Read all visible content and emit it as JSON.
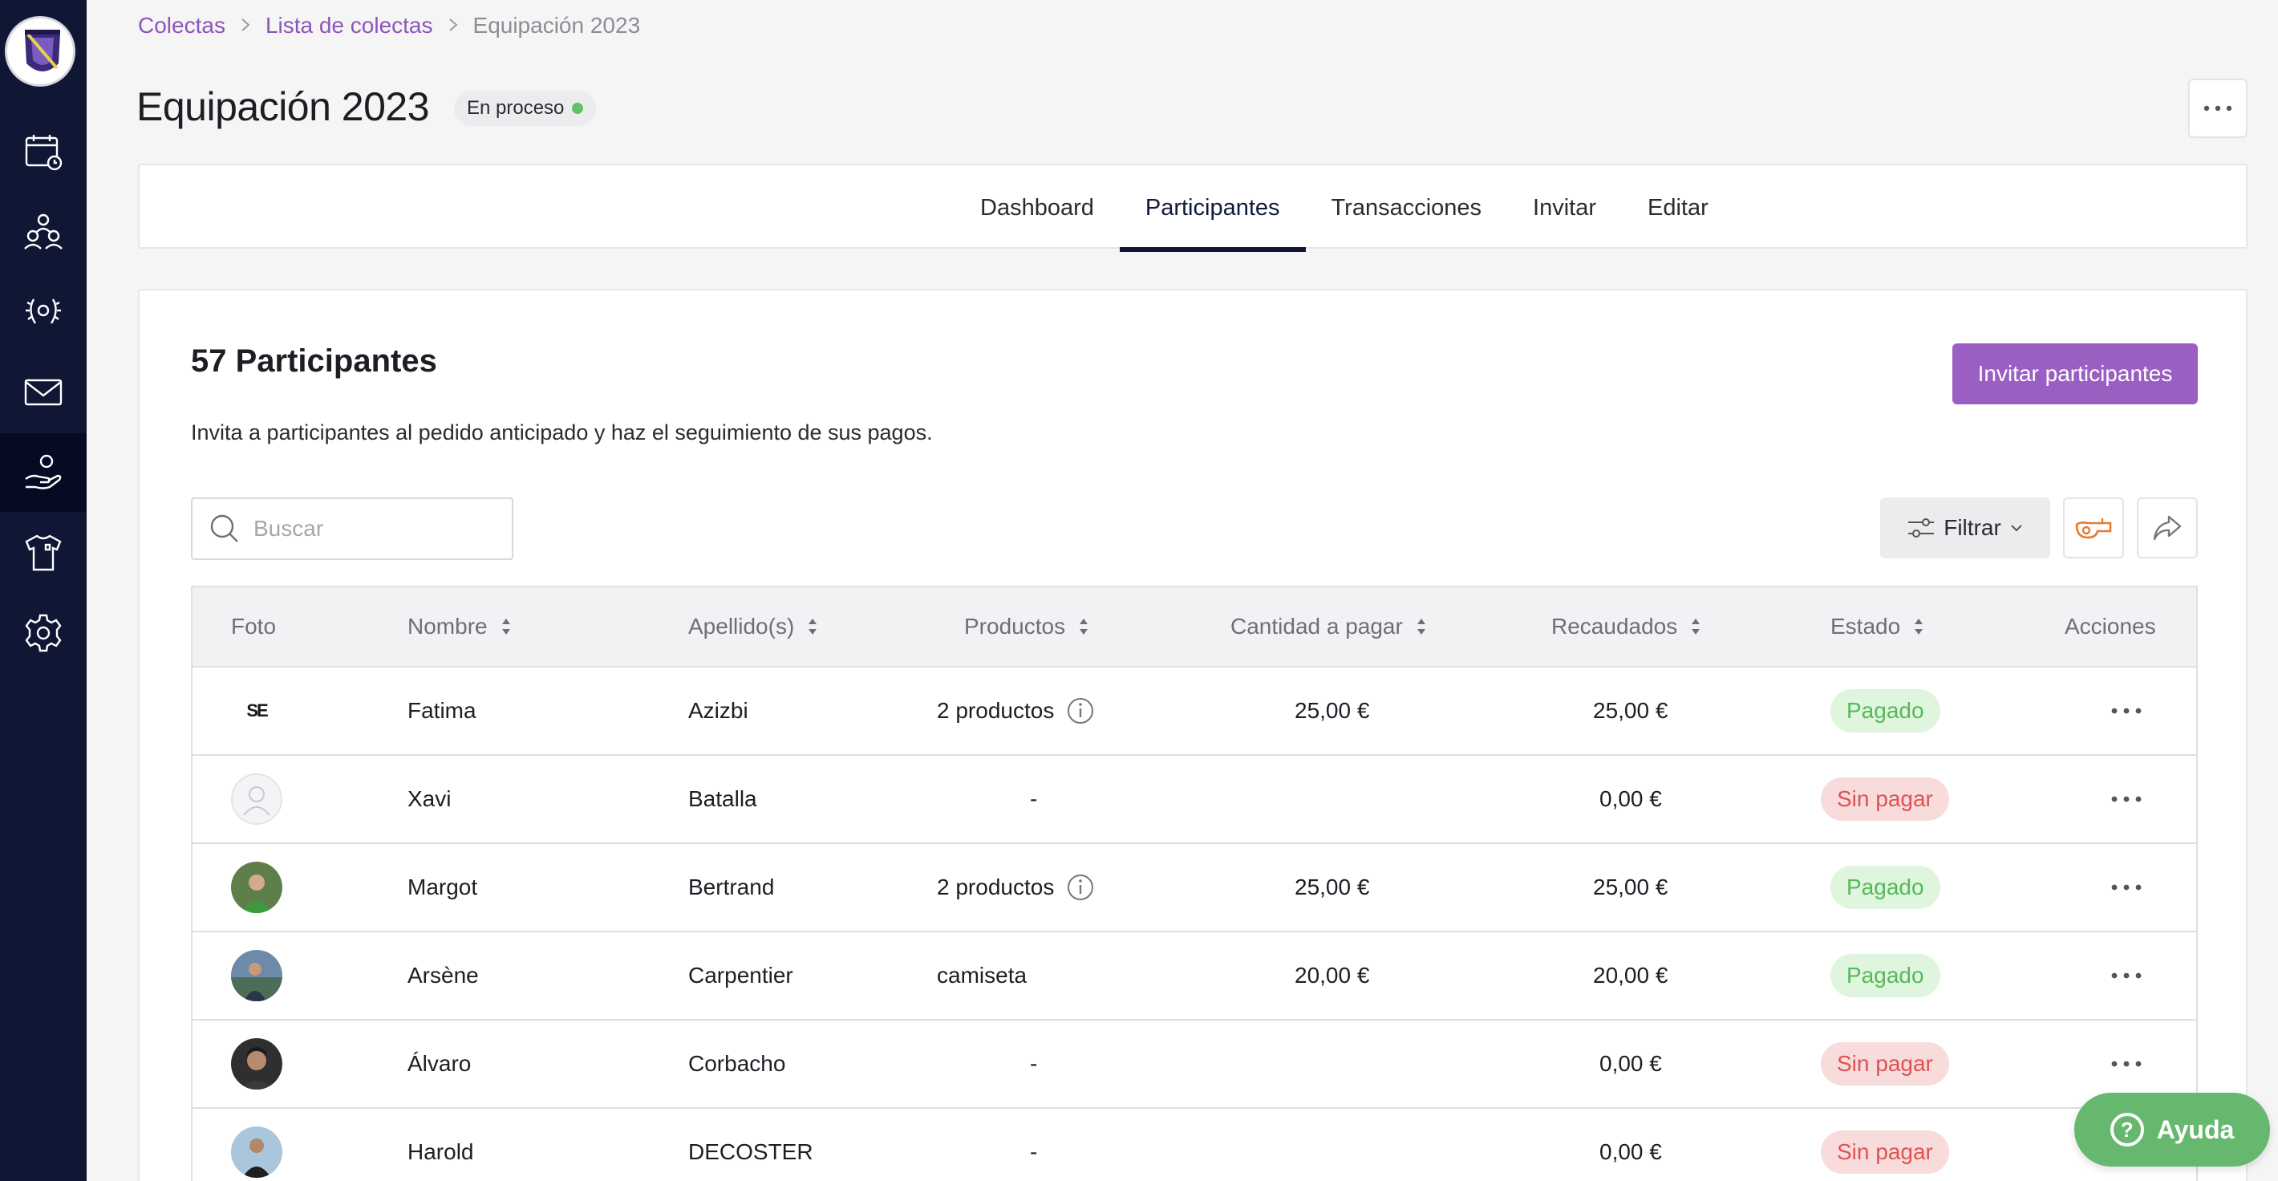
{
  "breadcrumb": {
    "items": [
      "Colectas",
      "Lista de colectas"
    ],
    "current": "Equipación 2023"
  },
  "page": {
    "title": "Equipación 2023",
    "status": "En proceso"
  },
  "tabs": [
    "Dashboard",
    "Participantes",
    "Transacciones",
    "Invitar",
    "Editar"
  ],
  "active_tab": "Participantes",
  "section": {
    "title": "57 Participantes",
    "description": "Invita a participantes al pedido anticipado y haz el seguimiento de sus pagos.",
    "invite_label": "Invitar participantes"
  },
  "search": {
    "placeholder": "Buscar"
  },
  "filter": {
    "label": "Filtrar"
  },
  "table": {
    "headers": [
      "Foto",
      "Nombre",
      "Apellido(s)",
      "Productos",
      "Cantidad a pagar",
      "Recaudados",
      "Estado",
      "Acciones"
    ],
    "rows": [
      {
        "nombre": "Fatima",
        "apellido": "Azizbi",
        "productos": "2 productos",
        "cantidad": "25,00 €",
        "recaudados": "25,00 €",
        "estado": "Pagado"
      },
      {
        "nombre": "Xavi",
        "apellido": "Batalla",
        "productos": "-",
        "cantidad": "",
        "recaudados": "0,00 €",
        "estado": "Sin pagar"
      },
      {
        "nombre": "Margot",
        "apellido": "Bertrand",
        "productos": "2 productos",
        "cantidad": "25,00 €",
        "recaudados": "25,00 €",
        "estado": "Pagado"
      },
      {
        "nombre": "Arsène",
        "apellido": "Carpentier",
        "productos": "camiseta",
        "cantidad": "20,00 €",
        "recaudados": "20,00 €",
        "estado": "Pagado"
      },
      {
        "nombre": "Álvaro",
        "apellido": "Corbacho",
        "productos": "-",
        "cantidad": "",
        "recaudados": "0,00 €",
        "estado": "Sin pagar"
      },
      {
        "nombre": "Harold",
        "apellido": "DECOSTER",
        "productos": "-",
        "cantidad": "",
        "recaudados": "0,00 €",
        "estado": "Sin pagar"
      }
    ]
  },
  "help": {
    "label": "Ayuda"
  },
  "avatar_logo_text": "SE",
  "colors": {
    "sidebar": "#0f1735",
    "accent": "#9b5fc4",
    "paid": "#56b85a",
    "unpaid": "#e05252",
    "help": "#67b86f"
  },
  "sidebar_icons": [
    "calendar-icon",
    "team-icon",
    "trophy-icon",
    "mail-icon",
    "donation-hand-icon",
    "shirt-icon",
    "settings-icon"
  ]
}
